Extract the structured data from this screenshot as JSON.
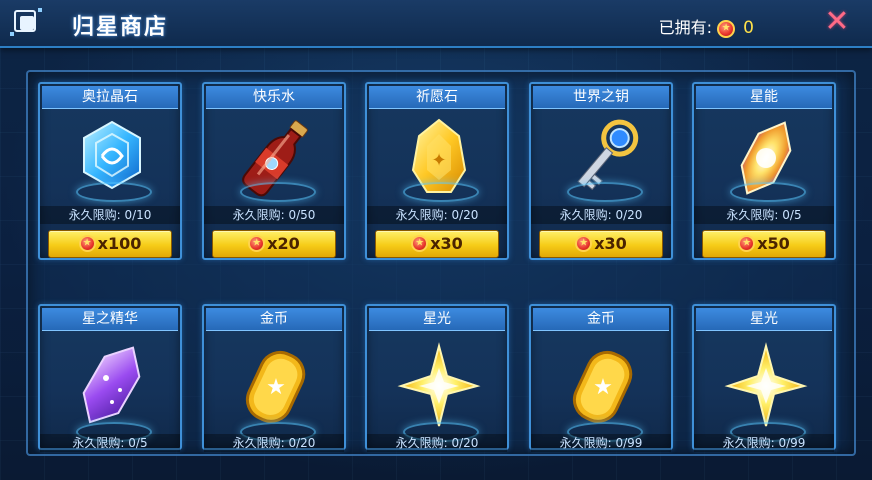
{
  "header": {
    "title": "归星商店",
    "owned_label": "已拥有:",
    "owned_value": "0",
    "close_symbol": "✕"
  },
  "currency_icon": "star-coin-icon",
  "items": [
    {
      "name": "奥拉晶石",
      "icon": "aura-crystal-icon",
      "limit": "永久限购: 0/10",
      "price": "x100"
    },
    {
      "name": "快乐水",
      "icon": "soda-bottle-icon",
      "limit": "永久限购: 0/50",
      "price": "x20"
    },
    {
      "name": "祈愿石",
      "icon": "wish-stone-icon",
      "limit": "永久限购: 0/20",
      "price": "x30"
    },
    {
      "name": "世界之钥",
      "icon": "world-key-icon",
      "limit": "永久限购: 0/20",
      "price": "x30"
    },
    {
      "name": "星能",
      "icon": "star-energy-crystal-icon",
      "limit": "永久限购: 0/5",
      "price": "x50"
    },
    {
      "name": "星之精华",
      "icon": "star-essence-crystal-icon",
      "limit": "永久限购: 0/5"
    },
    {
      "name": "金币",
      "icon": "gold-coin-icon",
      "limit": "永久限购: 0/20"
    },
    {
      "name": "星光",
      "icon": "starlight-icon",
      "limit": "永久限购: 0/20"
    },
    {
      "name": "金币",
      "icon": "gold-coin-icon",
      "limit": "永久限购: 0/99"
    },
    {
      "name": "星光",
      "icon": "starlight-icon",
      "limit": "永久限购: 0/99"
    }
  ],
  "colors": {
    "accent": "#3f90d8",
    "price_button": "#f6cc18",
    "owned_value": "#ffe14a",
    "close": "#ff6a86"
  }
}
